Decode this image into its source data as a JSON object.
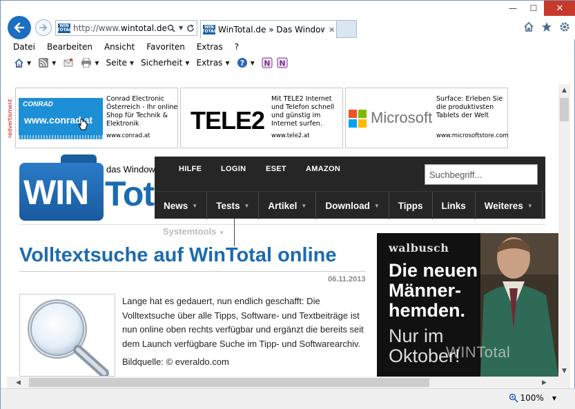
{
  "browser": {
    "address": {
      "prefix": "http://www.",
      "domain": "wintotal.de"
    },
    "tab": {
      "title": "WinTotal.de » Das Window..."
    },
    "favicon_text": "WIN TOTAL",
    "menu": [
      "Datei",
      "Bearbeiten",
      "Ansicht",
      "Favoriten",
      "Extras",
      "?"
    ],
    "commands": {
      "page": "Seite",
      "security": "Sicherheit",
      "tools": "Extras"
    },
    "zoom": "100%"
  },
  "ads": {
    "label": "redvertisment",
    "items": [
      {
        "logo": "CONRAD",
        "image_text": "www.conrad.at",
        "text": "Conrad Electronic Österreich - Ihr online Shop für Technik & Elektronik",
        "url": "www.conrad.at"
      },
      {
        "logo": "TELE2",
        "text": "Mit TELE2 Internet und Telefon schnell und günstig im Internet surfen.",
        "url": "www.tele2.at"
      },
      {
        "logo": "Microsoft",
        "text": "Surface: Erleben Sie die produktivsten Tablets der Welt",
        "url": "www.microsoftstore.com"
      }
    ]
  },
  "site": {
    "logo": {
      "part1": "WIN",
      "part2": "Tot",
      "tagline": "das Windows"
    },
    "top_nav": [
      "HILFE",
      "LOGIN",
      "ESET",
      "AMAZON"
    ],
    "search": {
      "placeholder": "Suchbegriff..."
    },
    "main_nav": [
      "News",
      "Tests",
      "Artikel",
      "Download",
      "Tipps",
      "Links",
      "Weiteres"
    ],
    "systemtools": "Systemtools"
  },
  "article": {
    "title": "Volltextsuche auf WinTotal online",
    "date": "06.11.2013",
    "body": "Lange hat es gedauert, nun endlich geschafft: Die Volltextsuche über alle Tipps, Software- und Textbeiträge ist nun online oben rechts verfügbar und ergänzt die bereits seit dem Launch verfügbare Suche im Tipp- und Softwarearchiv.",
    "credit": "Bildquelle: © everaldo.com"
  },
  "banner": {
    "brand": "walbusch",
    "headline": "Die neuen Männer-hemden.",
    "sub": "Nur im Oktober!",
    "watermark": "WINTotal"
  },
  "colors": {
    "accent": "#1b6bb0",
    "nav_bg": "#262626",
    "close_button": "#c7392b"
  }
}
